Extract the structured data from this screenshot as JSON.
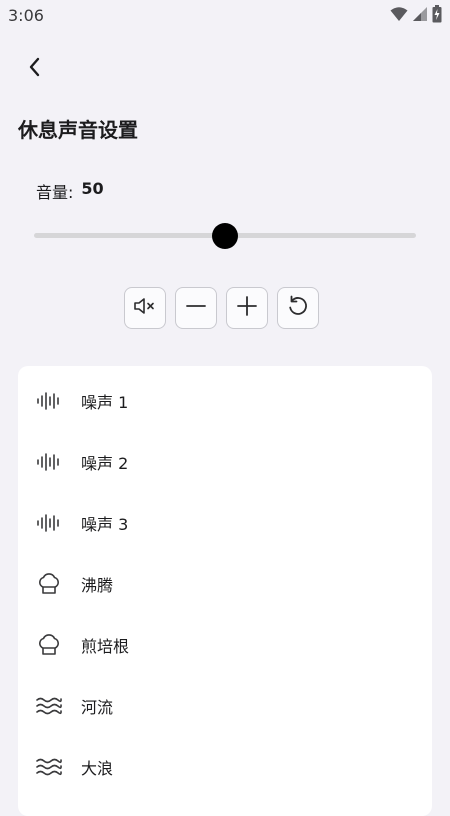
{
  "status_bar": {
    "time": "3:06"
  },
  "page": {
    "title": "休息声音设置"
  },
  "volume": {
    "label": "音量:",
    "value": "50",
    "level_percent": 50
  },
  "controls": {
    "buttons": [
      "mute",
      "decrease",
      "increase",
      "reset"
    ]
  },
  "sounds": [
    {
      "label": "噪声 1",
      "icon": "waveform-icon"
    },
    {
      "label": "噪声 2",
      "icon": "waveform-icon"
    },
    {
      "label": "噪声 3",
      "icon": "waveform-icon"
    },
    {
      "label": "沸腾",
      "icon": "chef-hat-icon"
    },
    {
      "label": "煎培根",
      "icon": "chef-hat-icon"
    },
    {
      "label": "河流",
      "icon": "waves-icon"
    },
    {
      "label": "大浪",
      "icon": "waves-icon"
    }
  ]
}
